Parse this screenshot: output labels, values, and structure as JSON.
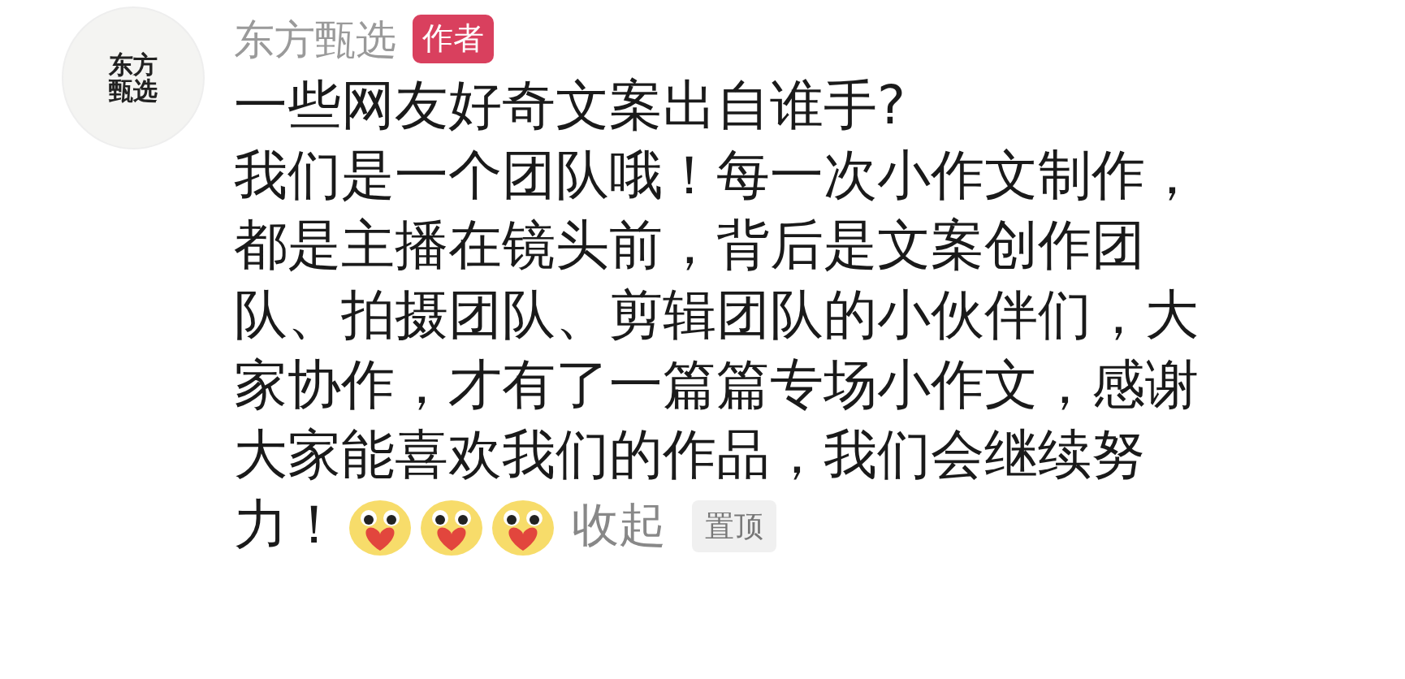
{
  "avatar": {
    "text": "东方甄选"
  },
  "author": {
    "name": "东方甄选",
    "badge": "作者"
  },
  "comment": {
    "lines": [
      "一些网友好奇文案出自谁手?",
      "我们是一个团队哦！每一次小作文制作，",
      "都是主播在镜头前，背后是文案创作团",
      "队、拍摄团队、剪辑团队的小伙伴们，大",
      "家协作，才有了一篇篇专场小作文，感谢",
      "大家能喜欢我们的作品，我们会继续努",
      "力！"
    ]
  },
  "actions": {
    "collapse": "收起",
    "pin": "置顶"
  }
}
